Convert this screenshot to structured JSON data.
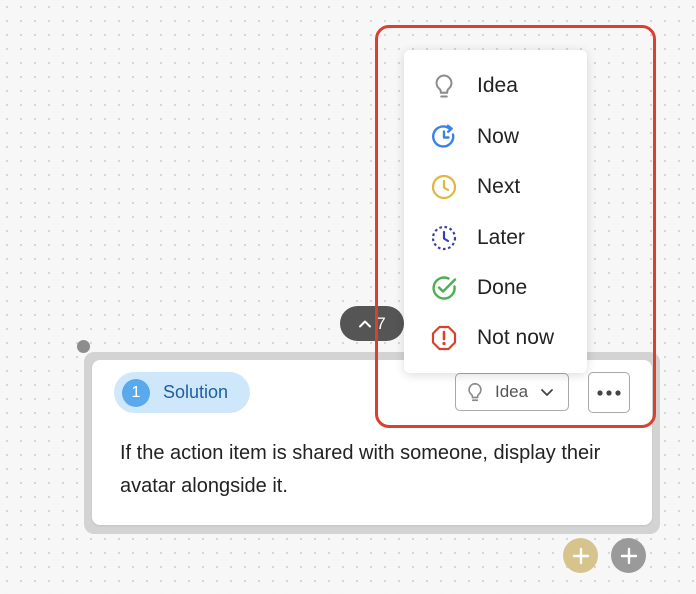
{
  "collapse_pill": {
    "count": "7"
  },
  "card": {
    "type_badge": {
      "number": "1",
      "label": "Solution"
    },
    "status_select": {
      "value": "Idea"
    },
    "description": "If the action item is shared with someone, display their avatar alongside it."
  },
  "status_menu": {
    "items": [
      {
        "label": "Idea",
        "icon": "lightbulb-icon",
        "color": "#8a8a8a"
      },
      {
        "label": "Now",
        "icon": "now-clock-icon",
        "color": "#3b82e6"
      },
      {
        "label": "Next",
        "icon": "clock-icon",
        "color": "#e0b63f"
      },
      {
        "label": "Later",
        "icon": "dashed-clock-icon",
        "color": "#3a3fa8"
      },
      {
        "label": "Done",
        "icon": "check-circle-icon",
        "color": "#4caf50"
      },
      {
        "label": "Not now",
        "icon": "octagon-alert-icon",
        "color": "#d9412f"
      }
    ]
  },
  "colors": {
    "highlight": "#d9412f",
    "badge_bg": "#cfe7fb",
    "badge_accent": "#5aa9ec",
    "add_gold": "#d7c48d",
    "add_gray": "#9a9a9a"
  }
}
